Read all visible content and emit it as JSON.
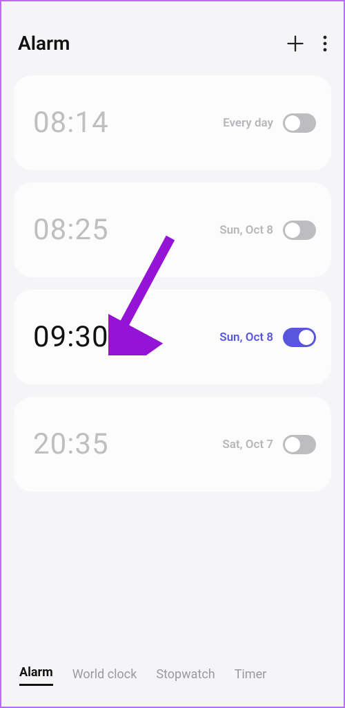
{
  "header": {
    "title": "Alarm"
  },
  "alarms": [
    {
      "time": "08:14",
      "label": "Every day",
      "enabled": false
    },
    {
      "time": "08:25",
      "label": "Sun, Oct 8",
      "enabled": false
    },
    {
      "time": "09:30",
      "label": "Sun, Oct 8",
      "enabled": true
    },
    {
      "time": "20:35",
      "label": "Sat, Oct 7",
      "enabled": false
    }
  ],
  "tabs": {
    "alarm": "Alarm",
    "world_clock": "World clock",
    "stopwatch": "Stopwatch",
    "timer": "Timer",
    "active": "alarm"
  },
  "colors": {
    "accent": "#5a55e0",
    "annotation": "#9413d6"
  }
}
